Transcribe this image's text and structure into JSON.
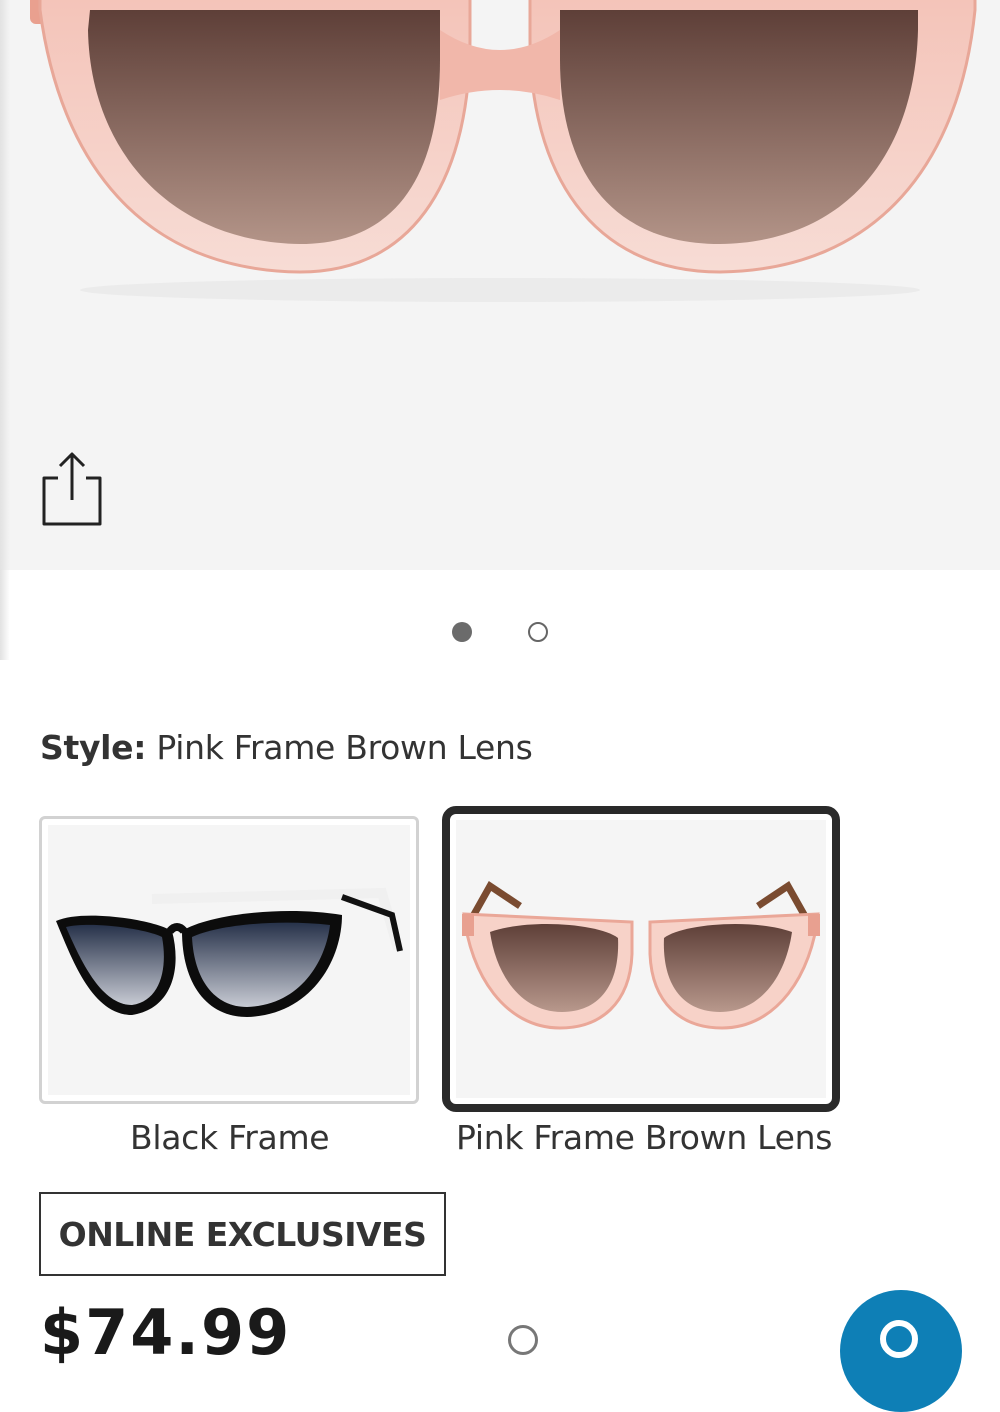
{
  "hero": {
    "image": "pink-frame-brown-lens-sunglasses",
    "share_icon": "share-icon",
    "carousel": {
      "count": 2,
      "active_index": 0
    }
  },
  "style": {
    "label": "Style:",
    "selected": "Pink Frame Brown Lens"
  },
  "swatches": [
    {
      "label": "Black Frame",
      "selected": false
    },
    {
      "label": "Pink Frame Brown Lens",
      "selected": true
    }
  ],
  "badge": {
    "label": "ONLINE EXCLUSIVES"
  },
  "price": {
    "value": "$74.99"
  },
  "colors": {
    "frame_pink": "#f2b8ad",
    "lens_brown": "#6e4a42",
    "chat_blue": "#0e7fb6",
    "selected_border": "#2a2a2a"
  }
}
